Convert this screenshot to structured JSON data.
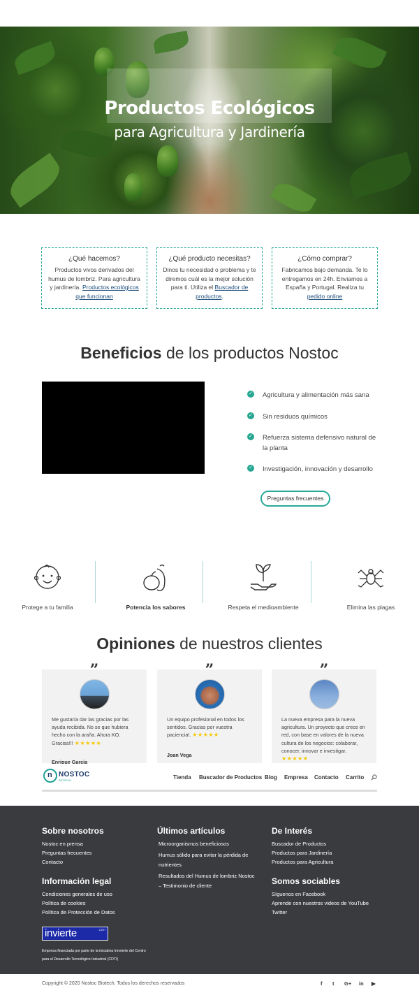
{
  "hero": {
    "title": "Productos Ecológicos",
    "subtitle": "para Agricultura y Jardinería"
  },
  "info_boxes": [
    {
      "title": "¿Qué hacemos?",
      "text": "Productos vivos derivados del humus de lombriz. Para agricultura y jardinería. ",
      "link": "Productos ecológicos que funcionan",
      "suffix": ""
    },
    {
      "title": "¿Qué producto necesitas?",
      "text": "Dinos tu necesidad o problema y te diremos cuál es la mejor solución para ti. Utiliza el ",
      "link": "Buscador de productos",
      "suffix": "."
    },
    {
      "title": "¿Cómo comprar?",
      "text": "Fabricamos bajo demanda. Te lo entregamos en 24h. Enviamos a España y Portugal. Realiza tu ",
      "link": "pedido online",
      "suffix": ""
    }
  ],
  "benefits": {
    "title_bold": "Beneficios",
    "title_rest": " de los productos Nostoc",
    "items": [
      "Agricultura y alimentación más sana",
      "Sin residuos químicos",
      "Refuerza sistema defensivo natural de la planta",
      "Investigación, innovación y desarrollo"
    ],
    "button": "Preguntas frecuentes",
    "check_color": "#24a690"
  },
  "features": [
    {
      "label": "Protege a tu familia",
      "icon": "baby-face-icon"
    },
    {
      "label": "Potencia los sabores",
      "icon": "vegetables-icon"
    },
    {
      "label": "Respeta el medioambiente",
      "icon": "plant-in-hand-icon"
    },
    {
      "label": "Elimina las plagas",
      "icon": "spider-icon"
    }
  ],
  "opinions": {
    "title_bold": "Opiniones",
    "title_rest": " de nuestros clientes",
    "cards": [
      {
        "text": "Me gustaría dar las gracias por las ayuda recibida. No se que hubiera hecho con la araña. Ahora KO. Gracias!!! ",
        "stars": "★★★★★",
        "author": "Enrique Garcia"
      },
      {
        "text": "Un equipo profesional en todos los sentidos. Gracias por vuestra paciencia!. ",
        "stars": "★★★★★",
        "author": "Joan Vega"
      },
      {
        "text": "La nueva empresa para la nueva agricultura. Un proyecto que crece en red, con base en valores de la nueva cultura de los negocios: colaborar, conocer, innovar e investigar. ",
        "stars": "★★★★★",
        "author": ""
      }
    ]
  },
  "nav": {
    "logo_text": "NOSTOC",
    "logo_sub": "BIOTECH",
    "logo_letter": "n",
    "items": [
      "Tienda",
      "Buscador de Productos",
      "Blog",
      "Empresa",
      "Contacto",
      "Carrito"
    ]
  },
  "footer": {
    "about": {
      "title": "Sobre nosotros",
      "links": [
        "Nostoc en prensa",
        "Preguntas frecuentes",
        "Contacto"
      ]
    },
    "articles": {
      "title": "Últimos artículos",
      "links": [
        "Microorganismos beneficiosos",
        "Humus sólido para evitar la pérdida de nutrientes",
        "Resultados del Humus de lombriz Nostoc – Testimonio de cliente"
      ]
    },
    "interest": {
      "title": "De Interés",
      "links": [
        "Buscador de Productos",
        "Productos para Jardinería",
        "Productos para Agricultura"
      ]
    },
    "legal": {
      "title": "Información legal",
      "links": [
        "Condiciones generales de uso",
        "Política de cookies",
        "Política de Protección de Datos"
      ]
    },
    "social": {
      "title": "Somos sociables",
      "links": [
        "Síguenos en Facebook",
        "Aprende con nuestros videos de YouTube",
        "Twitter"
      ]
    },
    "badge_text": "invierte",
    "badge_small": "CDTI",
    "funding_text": "Empresa financiada por parte de la iniciativa Innvierte del Centro para el Desarrollo Tecnológico Industrial (CDTI)"
  },
  "bottom": {
    "copyright": "Copyright © 2020 Nostoc Biotech. Todos los derechos reservados",
    "social_icons": [
      "f",
      "t",
      "G+",
      "in",
      "▶"
    ]
  }
}
